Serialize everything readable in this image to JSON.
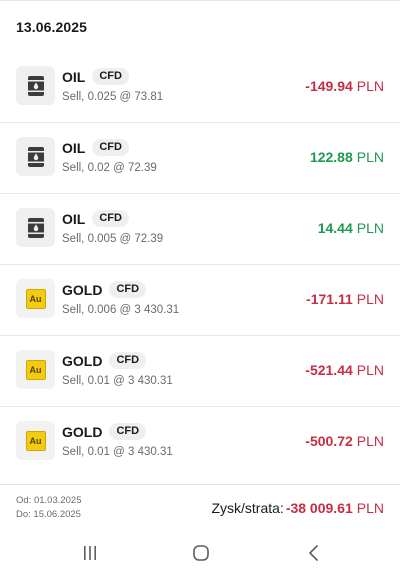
{
  "date_header": "13.06.2025",
  "currency": "PLN",
  "transactions": [
    {
      "instrument": "OIL",
      "type": "CFD",
      "details": "Sell, 0.025 @ 73.81",
      "amount": "-149.94",
      "icon": "oil-barrel-icon"
    },
    {
      "instrument": "OIL",
      "type": "CFD",
      "details": "Sell, 0.02 @ 72.39",
      "amount": "122.88",
      "icon": "oil-barrel-icon"
    },
    {
      "instrument": "OIL",
      "type": "CFD",
      "details": "Sell, 0.005 @ 72.39",
      "amount": "14.44",
      "icon": "oil-barrel-icon"
    },
    {
      "instrument": "GOLD",
      "type": "CFD",
      "details": "Sell, 0.006 @ 3 430.31",
      "amount": "-171.11",
      "icon": "gold-au-icon",
      "icon_text": "Au"
    },
    {
      "instrument": "GOLD",
      "type": "CFD",
      "details": "Sell, 0.01 @ 3 430.31",
      "amount": "-521.44",
      "icon": "gold-au-icon",
      "icon_text": "Au"
    },
    {
      "instrument": "GOLD",
      "type": "CFD",
      "details": "Sell, 0.01 @ 3 430.31",
      "amount": "-500.72",
      "icon": "gold-au-icon",
      "icon_text": "Au"
    }
  ],
  "footer": {
    "from": "Od: 01.03.2025",
    "to": "Do: 15.06.2025",
    "summary_label": "Zysk/strata:",
    "summary_value": "-38 009.61"
  },
  "navigation": {
    "recents": "recent-apps-icon",
    "home": "home-icon",
    "back": "back-icon"
  },
  "colors": {
    "negative": "#c62e46",
    "positive": "#1e9a4e",
    "gold_badge": "#f3cc12"
  }
}
